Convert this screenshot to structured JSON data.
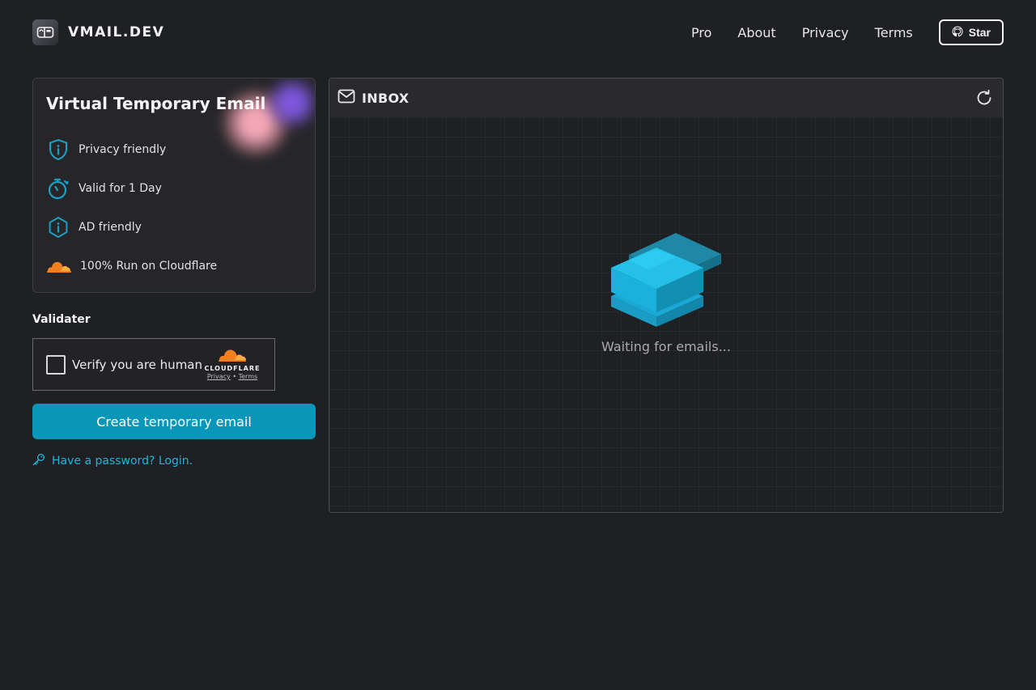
{
  "header": {
    "brand": "VMAIL.DEV",
    "nav": [
      "Pro",
      "About",
      "Privacy",
      "Terms"
    ],
    "star_label": "Star"
  },
  "card": {
    "title": "Virtual Temporary Email",
    "features": [
      {
        "icon": "shield-info-icon",
        "label": "Privacy friendly"
      },
      {
        "icon": "stopwatch-icon",
        "label": "Valid for 1 Day"
      },
      {
        "icon": "info-hexagon-icon",
        "label": "AD friendly"
      },
      {
        "icon": "cloudflare-cloud-icon",
        "label": "100% Run on Cloudflare"
      }
    ]
  },
  "validater": {
    "label": "Validater",
    "checkbox_label": "Verify you are human",
    "brand": "CLOUDFLARE",
    "privacy": "Privacy",
    "separator": "•",
    "terms": "Terms"
  },
  "actions": {
    "create": "Create temporary email",
    "login": "Have a password? Login."
  },
  "inbox": {
    "title": "INBOX",
    "empty_text": "Waiting for emails..."
  },
  "colors": {
    "accent": "#0a96b9",
    "link": "#21b4d8",
    "icon": "#1c9fc4",
    "cloudflare": "#f38020",
    "background": "#1f2023"
  }
}
